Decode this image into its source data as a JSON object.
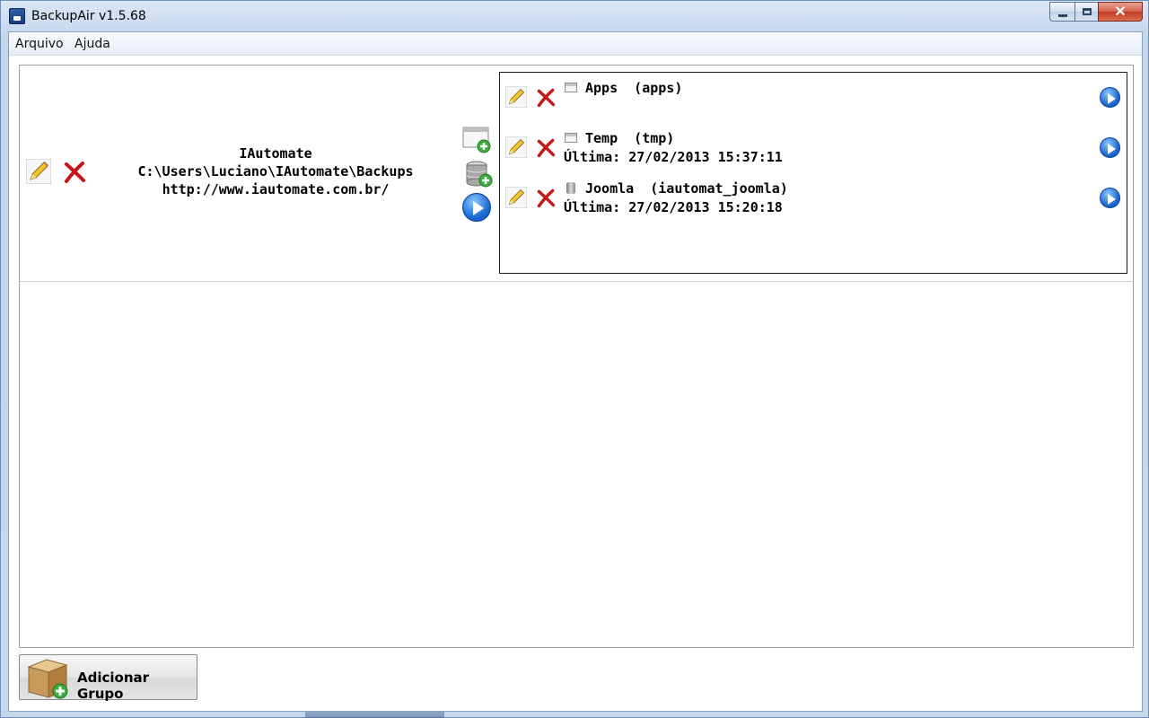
{
  "window": {
    "title": "BackupAir v1.5.68",
    "controls": {
      "minimize": "minimize",
      "maximize": "maximize",
      "close": "✕"
    }
  },
  "menu": {
    "items": [
      "Arquivo",
      "Ajuda"
    ]
  },
  "group": {
    "name": "IAutomate",
    "path": "C:\\Users\\Luciano\\IAutomate\\Backups",
    "url": "http://www.iautomate.com.br/",
    "actions": [
      "edit",
      "delete",
      "add-folder-job",
      "add-database-job",
      "run-group"
    ]
  },
  "jobs": [
    {
      "name": "Apps  (apps)",
      "type": "folder",
      "last": ""
    },
    {
      "name": "Temp  (tmp)",
      "type": "folder",
      "last": "Última: 27/02/2013 15:37:11"
    },
    {
      "name": "Joomla  (iautomat_joomla)",
      "type": "database",
      "last": "Última: 27/02/2013 15:20:18"
    }
  ],
  "footer": {
    "add_group_label": "Adicionar Grupo"
  },
  "colors": {
    "accent": "#1e6ed6",
    "delete": "#d21f1f",
    "frame": "#c4d6ec"
  }
}
